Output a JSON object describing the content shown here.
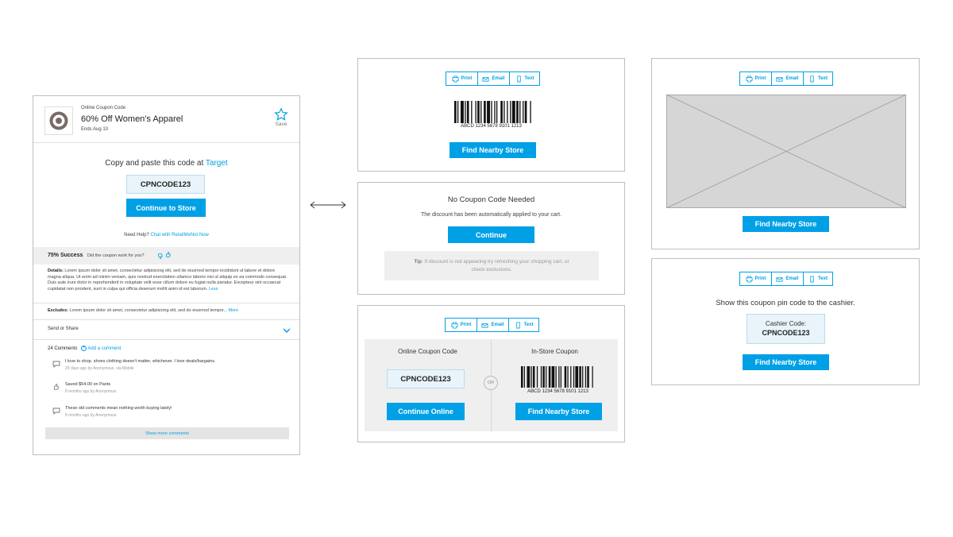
{
  "offer": {
    "kind_label": "Online Coupon Code",
    "title": "60% Off Women's Apparel",
    "ends": "Ends Aug 10",
    "save_label": "Save",
    "copy_prefix": "Copy and paste this code at",
    "store_link": "Target",
    "code": "CPNCODE123",
    "continue_label": "Continue to Store",
    "help_prefix": "Need Help?",
    "help_link": "Chat with RetailMeNot Now",
    "success_rate": "75% Success",
    "feedback_question": "Did the coupon work for you?",
    "details_label": "Details:",
    "details_text": "Lorem ipsum dolor sit amet, consectetur adipisicing elit, sed do eiusmod tempor incididunt ut labore et dolore magna aliqua. Ut enim ad minim veniam, quis nostrud exercitation ullamco laboris nisi ut aliquip ex ea commodo consequat. Duis aute irure dolor in reprehenderit in voluptate velit esse cillum dolore eu fugiat nulla pariatur. Excepteur sint occaecat cupidatat non proident, sunt in culpa qui officia deserunt mollit anim id est laborum.",
    "details_less": "Less",
    "excludes_label": "Excludes:",
    "excludes_text": "Lorem ipsum dolor sit amet, consectetur adipisicing elit, sed do eiusmod tempor...",
    "excludes_more": "More",
    "send_share": "Send or Share",
    "comments_count": "24 Comments",
    "add_comment": "Add a comment",
    "comments": [
      {
        "icon": "comment-icon",
        "text": "I love to shop. shoes clothing doesn't matter, whichever. I love deals/bargains.",
        "meta": "29 days ago by Anonymous, via Mobile"
      },
      {
        "icon": "thumbs-up-icon",
        "text": "Saved $54.00 on Pants",
        "meta": "8 months ago by Anonymous"
      },
      {
        "icon": "comment-icon",
        "text": "These old comments mean nothing worth buying lately!",
        "meta": "8 months ago by Anonymous"
      }
    ],
    "show_more": "Show more comments"
  },
  "share": {
    "print": "Print",
    "email": "Email",
    "text": "Text"
  },
  "barcode_number": "ABCD 1234 5678 9101 1213",
  "find_store": "Find Nearby Store",
  "no_code": {
    "title": "No Coupon Code Needed",
    "desc": "The discount has been automatically applied to your cart.",
    "continue": "Continue",
    "tip_label": "Tip",
    "tip_text": ": If discount is not appearing try refreshing your shopping cart, or check exclusions."
  },
  "combo": {
    "online_title": "Online Coupon Code",
    "code": "CPNCODE123",
    "continue_online": "Continue Online",
    "or": "OR",
    "instore_title": "In-Store Coupon"
  },
  "pin": {
    "instruction": "Show this coupon pin code to the cashier.",
    "cashier_label": "Cashier Code:",
    "code": "CPNCODE123"
  },
  "colors": {
    "accent": "#00a0e6",
    "code_bg": "#e8f4fa",
    "gray_bg": "#efefef"
  }
}
